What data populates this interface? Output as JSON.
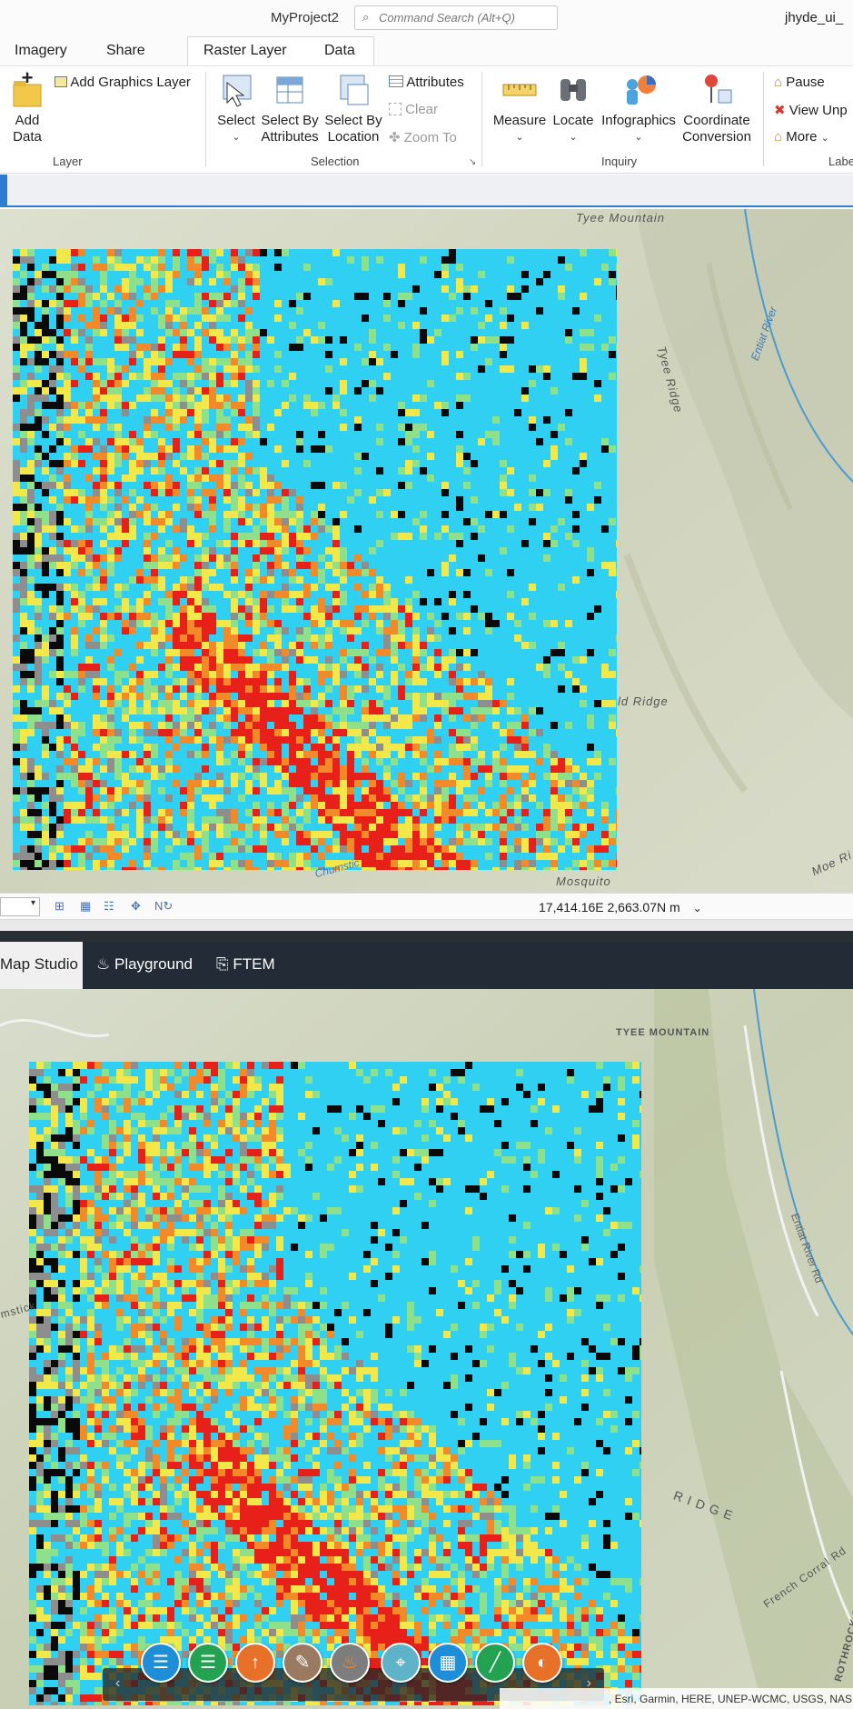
{
  "app": {
    "title": "MyProject2",
    "search_placeholder": "Command Search (Alt+Q)",
    "user": "jhyde_ui_"
  },
  "ribbon_tabs": [
    "Imagery",
    "Share",
    "Raster Layer",
    "Data"
  ],
  "ribbon": {
    "layer_group": {
      "label": "Layer",
      "add_data": "Add Data",
      "add_graphics_layer": "Add Graphics Layer"
    },
    "selection_group": {
      "label": "Selection",
      "select": "Select",
      "select_by_attributes": "Select By Attributes",
      "select_by_location": "Select By Location",
      "attributes": "Attributes",
      "clear": "Clear",
      "zoom_to": "Zoom To"
    },
    "inquiry_group": {
      "label": "Inquiry",
      "measure": "Measure",
      "locate": "Locate",
      "infographics": "Infographics",
      "coordinate_conversion": "Coordinate Conversion"
    },
    "labeling_group": {
      "label": "Labe",
      "pause": "Pause",
      "view_unplaced": "View Unp",
      "more": "More"
    }
  },
  "map1": {
    "labels": {
      "tyee_mountain": "Tyee Mountain",
      "tyee_ridge": "Tyee Ridge",
      "entiat_river": "Entiat River",
      "ridge": "ld Ridge",
      "mosquito": "Mosquito",
      "moe_ridge": "Moe Ri",
      "chumstick": "Chumstic"
    }
  },
  "status_bar": {
    "coords": "17,414.16E 2,663.07N m"
  },
  "web_nav": {
    "tabs": [
      "Map Studio",
      "Playground",
      "FTEM"
    ]
  },
  "map2": {
    "labels": {
      "tyee_mountain": "TYEE MOUNTAIN",
      "entiat_river_rd": "Entiat River Rd",
      "french_corral": "French Corral Rd",
      "rothrock_ridge": "ROTHROCK RIDGE",
      "ridge": "R I D G E",
      "chumstick": "mstick"
    },
    "attribution": ", Esri, Garmin, HERE, UNEP-WCMC, USGS, NAS"
  },
  "colors": {
    "cyan": "#2fd0f2",
    "red": "#e8201a",
    "orange": "#f28a2a",
    "yellow": "#f2e84a",
    "green": "#8fe08a",
    "black": "#0a0a0a",
    "grey": "#8e8e8e",
    "accent_blue": "#2f7dd1"
  },
  "toolbar_icons": [
    "layers-icon",
    "layer-edit-icon",
    "upload-icon",
    "eraser-icon",
    "fire-icon",
    "marker-icon",
    "grid-icon",
    "ruler-icon",
    "palette-icon"
  ]
}
